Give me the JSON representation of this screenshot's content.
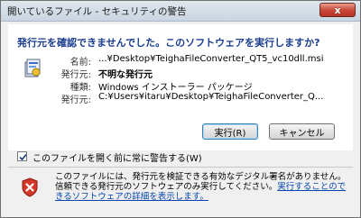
{
  "window": {
    "title": "開いているファイル - セキュリティの警告",
    "close_label": "x"
  },
  "dialog": {
    "heading": "発行元を確認できませんでした。このソフトウェアを実行しますか?",
    "details": [
      {
        "label": "名前:",
        "value": "...¥Desktop¥TeighaFileConverter_QT5_vc10dll.msi"
      },
      {
        "label": "発行元:",
        "value": "不明な発行元"
      },
      {
        "label": "種類:",
        "value": "Windows インストーラー パッケージ"
      },
      {
        "label": "発行元:",
        "value": "C:¥Users¥itaru¥Desktop¥TeighaFileConverter_Q..."
      }
    ]
  },
  "buttons": {
    "run": "実行(R)",
    "cancel": "キャンセル"
  },
  "checkbox": {
    "label": "このファイルを開く前に常に警告する(W)",
    "checked": true
  },
  "footer": {
    "text": "このファイルには、発行元を検証できる有効なデジタル署名がありません。信頼できる発行元のソフトウェアのみ実行してください。",
    "link": "実行することのできるソフトウェアの詳細を表示します。"
  },
  "icons": {
    "app": "installer-package-icon",
    "warning": "shield-error-icon",
    "close": "close-icon",
    "check": "checkmark-icon"
  }
}
